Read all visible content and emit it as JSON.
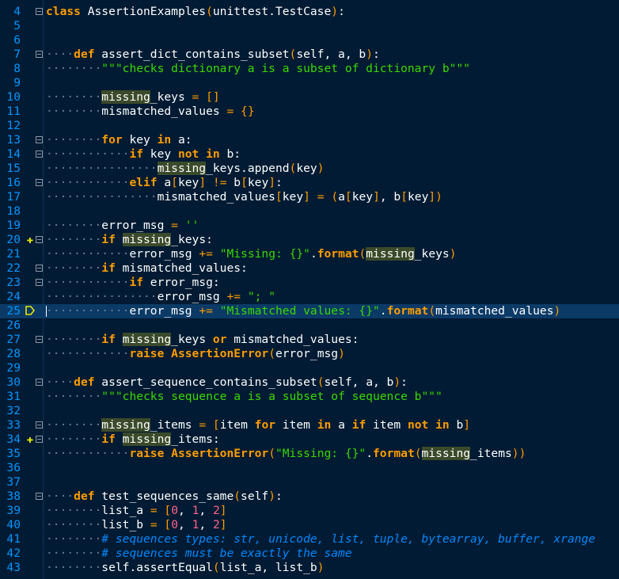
{
  "editor": {
    "current_line": 25,
    "bookmark_lines": [
      20,
      34
    ],
    "fold_lines": [
      4,
      7,
      13,
      14,
      16,
      20,
      22,
      23,
      27,
      30,
      33,
      34,
      38
    ],
    "lines": [
      {
        "n": "4",
        "code": "class AssertionExamples(unittest.TestCase):"
      },
      {
        "n": "5",
        "code": ""
      },
      {
        "n": "6",
        "code": ""
      },
      {
        "n": "7",
        "code": "    def assert_dict_contains_subset(self, a, b):"
      },
      {
        "n": "8",
        "code": "        \"\"\"checks dictionary a is a subset of dictionary b\"\"\""
      },
      {
        "n": "9",
        "code": ""
      },
      {
        "n": "10",
        "code": "        missing_keys = []"
      },
      {
        "n": "11",
        "code": "        mismatched_values = {}"
      },
      {
        "n": "12",
        "code": ""
      },
      {
        "n": "13",
        "code": "        for key in a:"
      },
      {
        "n": "14",
        "code": "            if key not in b:"
      },
      {
        "n": "15",
        "code": "                missing_keys.append(key)"
      },
      {
        "n": "16",
        "code": "            elif a[key] != b[key]:"
      },
      {
        "n": "17",
        "code": "                mismatched_values[key] = (a[key], b[key])"
      },
      {
        "n": "18",
        "code": ""
      },
      {
        "n": "19",
        "code": "        error_msg = ''"
      },
      {
        "n": "20",
        "code": "        if missing_keys:"
      },
      {
        "n": "21",
        "code": "            error_msg += \"Missing: {}\".format(missing_keys)"
      },
      {
        "n": "22",
        "code": "        if mismatched_values:"
      },
      {
        "n": "23",
        "code": "            if error_msg:"
      },
      {
        "n": "24",
        "code": "                error_msg += \"; \""
      },
      {
        "n": "25",
        "code": "            error_msg += \"Mismatched values: {}\".format(mismatched_values)"
      },
      {
        "n": "26",
        "code": ""
      },
      {
        "n": "27",
        "code": "        if missing_keys or mismatched_values:"
      },
      {
        "n": "28",
        "code": "            raise AssertionError(error_msg)"
      },
      {
        "n": "29",
        "code": ""
      },
      {
        "n": "30",
        "code": "    def assert_sequence_contains_subset(self, a, b):"
      },
      {
        "n": "31",
        "code": "        \"\"\"checks sequence a is a subset of sequence b\"\"\""
      },
      {
        "n": "32",
        "code": ""
      },
      {
        "n": "33",
        "code": "        missing_items = [item for item in a if item not in b]"
      },
      {
        "n": "34",
        "code": "        if missing_items:"
      },
      {
        "n": "35",
        "code": "            raise AssertionError(\"Missing: {}\".format(missing_items))"
      },
      {
        "n": "36",
        "code": ""
      },
      {
        "n": "37",
        "code": ""
      },
      {
        "n": "38",
        "code": "    def test_sequences_same(self):"
      },
      {
        "n": "39",
        "code": "        list_a = [0, 1, 2]"
      },
      {
        "n": "40",
        "code": "        list_b = [0, 1, 2]"
      },
      {
        "n": "41",
        "code": "        # sequences types: str, unicode, list, tuple, bytearray, buffer, xrange"
      },
      {
        "n": "42",
        "code": "        # sequences must be exactly the same"
      },
      {
        "n": "43",
        "code": "        self.assertEqual(list_a, list_b)"
      }
    ]
  }
}
